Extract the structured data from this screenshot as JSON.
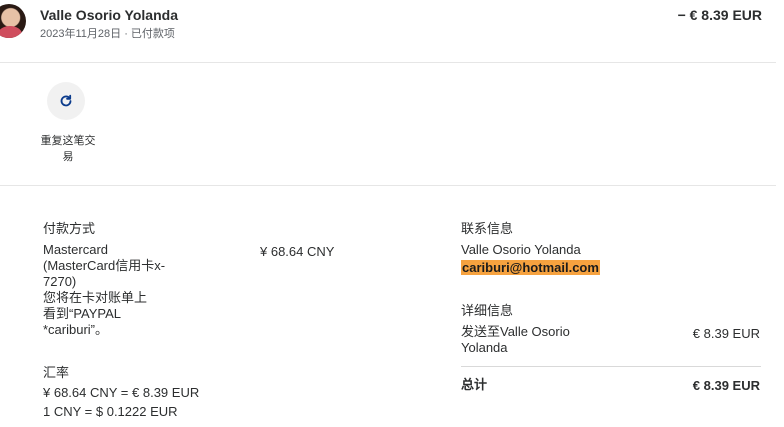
{
  "header": {
    "name": "Valle Osorio Yolanda",
    "date": "2023年11月28日",
    "separator": "·",
    "status": "已付款项",
    "amount": "− € 8.39 EUR"
  },
  "actions": {
    "repeat_label": "重复这笔交易"
  },
  "payment": {
    "section_title": "付款方式",
    "method_lines": [
      "Mastercard",
      "(MasterCard信用卡x-",
      "7270)",
      "您将在卡对账单上",
      "看到“PAYPAL",
      "*cariburi”。"
    ],
    "amount_cny": "¥ 68.64 CNY"
  },
  "exchange": {
    "section_title": "汇率",
    "line1": "¥ 68.64 CNY = € 8.39 EUR",
    "line2": "1 CNY = $ 0.1222 EUR"
  },
  "contact": {
    "section_title": "联系信息",
    "name": "Valle Osorio Yolanda",
    "email": "cariburi@hotmail.com"
  },
  "details": {
    "section_title": "详细信息",
    "sent_to_line1": "发送至Valle Osorio",
    "sent_to_line2": "Yolanda",
    "sent_amount": "€ 8.39 EUR",
    "total_label": "总计",
    "total_amount": "€ 8.39 EUR"
  }
}
